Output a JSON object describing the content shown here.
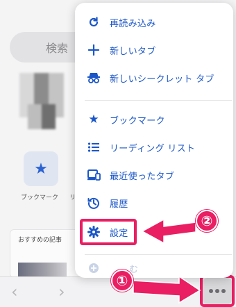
{
  "background": {
    "search_label": "検索",
    "bookmark_tile_label": "ブックマーク",
    "bookmark_tile_label2": "リ",
    "recommended_title": "おすすめの記事"
  },
  "menu": {
    "items": [
      {
        "label": "再読み込み",
        "icon": "refresh-icon"
      },
      {
        "label": "新しいタブ",
        "icon": "plus-icon"
      },
      {
        "label": "新しいシークレット タブ",
        "icon": "incognito-icon"
      },
      {
        "label": "ブックマーク",
        "icon": "star-icon"
      },
      {
        "label": "リーディング リスト",
        "icon": "list-icon"
      },
      {
        "label": "最近使ったタブ",
        "icon": "devices-icon"
      },
      {
        "label": "履歴",
        "icon": "history-icon"
      },
      {
        "label": "設定",
        "icon": "gear-icon"
      },
      {
        "label": "む",
        "icon": "add-icon"
      }
    ]
  },
  "callouts": {
    "step1": "①",
    "step2": "②",
    "highlight_color": "#e91e63"
  },
  "toolbar": {
    "back": "‹",
    "forward": "›"
  }
}
